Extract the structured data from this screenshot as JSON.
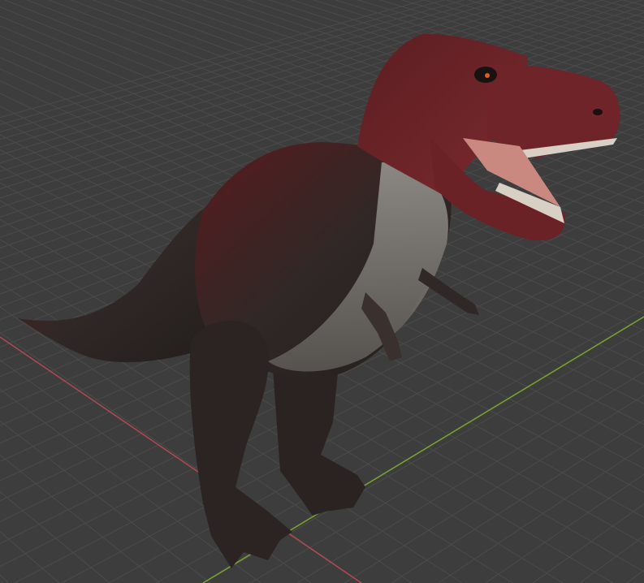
{
  "viewport": {
    "background": "#3d3d3d",
    "grid_color": "#4b4b4b",
    "x_axis_color": "#b5494f",
    "y_axis_color": "#7aa62f"
  },
  "model": {
    "name_icon": "trex-model",
    "body_color": "#2f2a28",
    "accent_color": "#6a1c20",
    "belly_color": "#8c8a85",
    "mouth_color": "#c98880"
  }
}
